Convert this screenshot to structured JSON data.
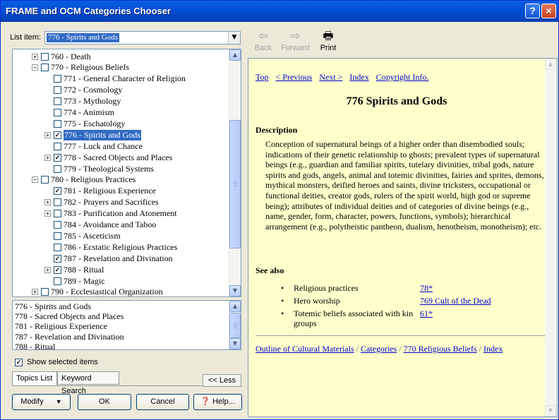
{
  "window": {
    "title": "FRAME and OCM Categories Chooser",
    "help_btn": "?",
    "close_btn": "×"
  },
  "list_item": {
    "label": "List item:",
    "value": "776 - Spirits and Gods"
  },
  "tree": [
    {
      "text": "760 - Death",
      "checked": false,
      "expander": "+",
      "indent": 0
    },
    {
      "text": "770 - Religious Beliefs",
      "checked": false,
      "expander": "−",
      "indent": 0
    },
    {
      "text": "771 - General Character of Religion",
      "checked": false,
      "expander": "",
      "indent": 1
    },
    {
      "text": "772 - Cosmology",
      "checked": false,
      "expander": "",
      "indent": 1
    },
    {
      "text": "773 - Mythology",
      "checked": false,
      "expander": "",
      "indent": 1
    },
    {
      "text": "774 - Animism",
      "checked": false,
      "expander": "",
      "indent": 1
    },
    {
      "text": "775 - Eschatology",
      "checked": false,
      "expander": "",
      "indent": 1
    },
    {
      "text": "776 - Spirits and Gods",
      "checked": true,
      "expander": "+",
      "indent": 1,
      "selected": true
    },
    {
      "text": "777 - Luck and Chance",
      "checked": false,
      "expander": "",
      "indent": 1
    },
    {
      "text": "778 - Sacred Objects and Places",
      "checked": true,
      "expander": "+",
      "indent": 1
    },
    {
      "text": "779 - Theological Systems",
      "checked": false,
      "expander": "",
      "indent": 1
    },
    {
      "text": "780 - Religious Practices",
      "checked": false,
      "expander": "−",
      "indent": 0
    },
    {
      "text": "781 - Religious Experience",
      "checked": true,
      "expander": "",
      "indent": 1
    },
    {
      "text": "782 - Prayers and Sacrifices",
      "checked": false,
      "expander": "+",
      "indent": 1
    },
    {
      "text": "783 - Purification and Atonement",
      "checked": false,
      "expander": "+",
      "indent": 1
    },
    {
      "text": "784 - Avoidance and Taboo",
      "checked": false,
      "expander": "",
      "indent": 1
    },
    {
      "text": "785 - Asceticism",
      "checked": false,
      "expander": "",
      "indent": 1
    },
    {
      "text": "786 - Ecstatic Religious Practices",
      "checked": false,
      "expander": "",
      "indent": 1
    },
    {
      "text": "787 - Revelation and Divination",
      "checked": true,
      "expander": "",
      "indent": 1
    },
    {
      "text": "788 - Ritual",
      "checked": true,
      "expander": "+",
      "indent": 1
    },
    {
      "text": "789 - Magic",
      "checked": false,
      "expander": "",
      "indent": 1
    },
    {
      "text": "790 - Ecclesiastical Organization",
      "checked": false,
      "expander": "+",
      "indent": 0
    }
  ],
  "selected_items": [
    "776 - Spirits and Gods",
    "778 - Sacred Objects and Places",
    "781 - Religious Experience",
    "787 - Revelation and Divination",
    "788 - Ritual"
  ],
  "show_selected": {
    "label": "Show selected items",
    "checked": true
  },
  "tabs": [
    "Topics List",
    "Keyword Search"
  ],
  "less_btn": "<< Less",
  "buttons": {
    "modify": "Modify",
    "ok": "OK",
    "cancel": "Cancel",
    "help": "Help..."
  },
  "toolbar": {
    "back": "Back",
    "forward": "Forward",
    "print": "Print"
  },
  "nav_links": [
    "Top",
    "< Previous",
    "Next >",
    "Index",
    "Copyright Info."
  ],
  "heading": "776 Spirits and Gods",
  "description_heading": "Description",
  "description": "Conception of supernatural beings of a higher order than disembodied souls; indications of their genetic relationship to ghosts; prevalent types of supernatural beings (e.g., guardian and familiar spirits, tutelary divinities, tribal gods, nature spirits and gods, angels, animal and totemic divinities, fairies and sprites, demons, mythical monsters, deified heroes and saints, divine tricksters, occupational or functional deities, creator gods, rulers of the spirit world, high god or supreme being); attributes of individual deities and of categories of divine beings (e.g., name, gender, form, character, powers, functions, symbols); hierarchical arrangement (e.g., polytheistic pantheon, dualism, henotheism, monotheism); etc.",
  "see_also_heading": "See also",
  "see_also": [
    {
      "label": "Religious practices",
      "link": "78*"
    },
    {
      "label": "Hero worship",
      "link": "769 Cult of the Dead"
    },
    {
      "label": "Totemic beliefs associated with kin groups",
      "link": "61*"
    }
  ],
  "footer_links": [
    "Outline of Cultural Materials",
    "Categories",
    "770 Religious Beliefs",
    "Index"
  ]
}
